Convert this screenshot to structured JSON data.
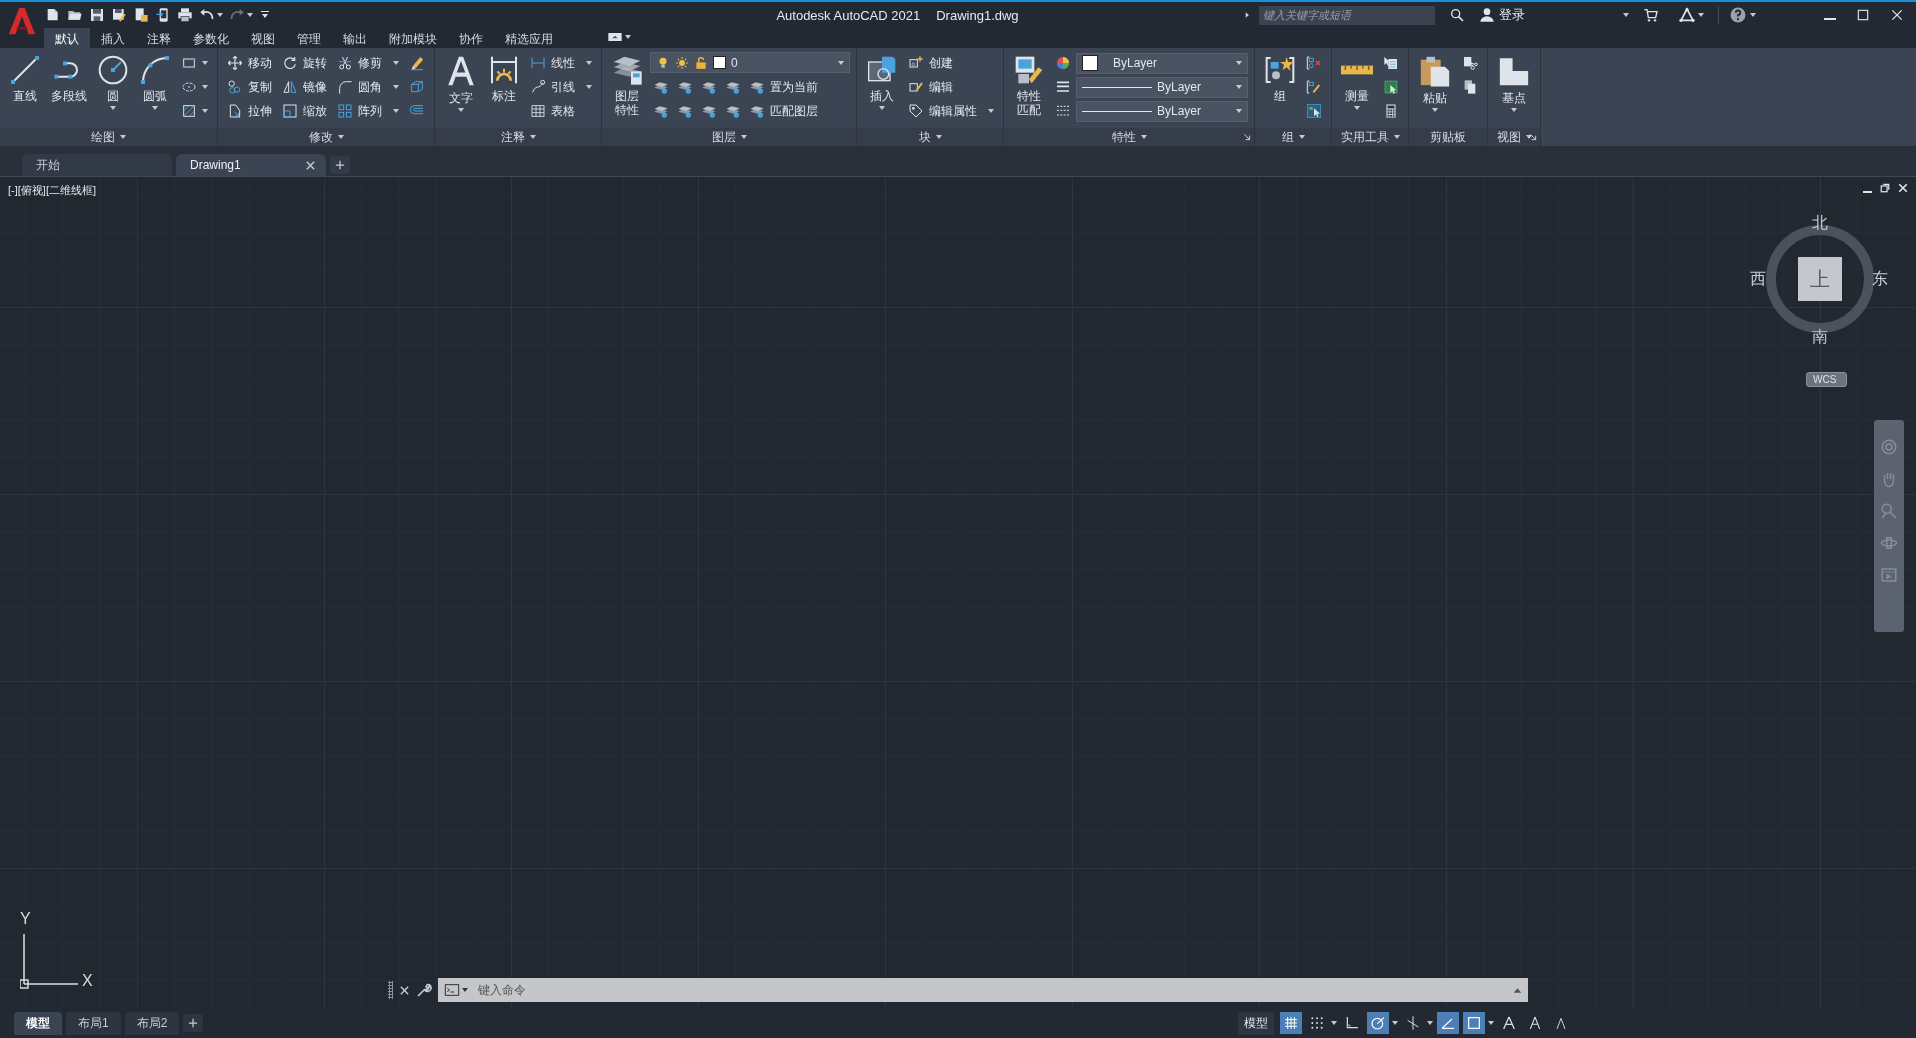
{
  "title_bar": {
    "app_title": "Autodesk AutoCAD 2021",
    "file_name": "Drawing1.dwg",
    "search": {
      "placeholder": "键入关键字或短语"
    },
    "sign_in": "登录"
  },
  "ribbon_tabs": [
    {
      "label": "默认",
      "selected": true
    },
    {
      "label": "插入",
      "selected": false
    },
    {
      "label": "注释",
      "selected": false
    },
    {
      "label": "参数化",
      "selected": false
    },
    {
      "label": "视图",
      "selected": false
    },
    {
      "label": "管理",
      "selected": false
    },
    {
      "label": "输出",
      "selected": false
    },
    {
      "label": "附加模块",
      "selected": false
    },
    {
      "label": "协作",
      "selected": false
    },
    {
      "label": "精选应用",
      "selected": false
    }
  ],
  "ribbon_panels": [
    {
      "title": "绘图",
      "menu": true,
      "launcher": false,
      "columns": [
        {
          "kind": "large",
          "label": "直线",
          "dropdown": false
        },
        {
          "kind": "large",
          "label": "多段线",
          "dropdown": false
        },
        {
          "kind": "large",
          "label": "圆",
          "dropdown": true
        },
        {
          "kind": "large",
          "label": "圆弧",
          "dropdown": true
        },
        {
          "kind": "stack",
          "items": [
            {
              "kind": "icon",
              "dropdown": true
            },
            {
              "kind": "icon",
              "dropdown": true
            },
            {
              "kind": "icon",
              "dropdown": true
            }
          ]
        }
      ]
    },
    {
      "title": "修改",
      "menu": true,
      "launcher": false,
      "columns": [
        {
          "kind": "stack",
          "items": [
            {
              "kind": "small",
              "label": "移动",
              "dropdown": false
            },
            {
              "kind": "small",
              "label": "复制",
              "dropdown": false
            },
            {
              "kind": "small",
              "label": "拉伸",
              "dropdown": false
            }
          ]
        },
        {
          "kind": "stack",
          "items": [
            {
              "kind": "small",
              "label": "旋转",
              "dropdown": false
            },
            {
              "kind": "small",
              "label": "镜像",
              "dropdown": false
            },
            {
              "kind": "small",
              "label": "缩放",
              "dropdown": false
            }
          ]
        },
        {
          "kind": "stack",
          "items": [
            {
              "kind": "small",
              "label": "修剪",
              "dropdown": true
            },
            {
              "kind": "small",
              "label": "圆角",
              "dropdown": true
            },
            {
              "kind": "small",
              "label": "阵列",
              "dropdown": true
            }
          ]
        },
        {
          "kind": "stack",
          "items": [
            {
              "kind": "icon",
              "dropdown": false
            },
            {
              "kind": "icon",
              "dropdown": false
            },
            {
              "kind": "icon",
              "dropdown": false
            }
          ]
        }
      ]
    },
    {
      "title": "注释",
      "menu": true,
      "launcher": false,
      "columns": [
        {
          "kind": "large",
          "label": "文字",
          "dropdown": true
        },
        {
          "kind": "large",
          "label": "标注",
          "dropdown": false
        },
        {
          "kind": "stack",
          "items": [
            {
              "kind": "small",
              "label": "线性",
              "dropdown": true
            },
            {
              "kind": "small",
              "label": "引线",
              "dropdown": true
            },
            {
              "kind": "small",
              "label": "表格",
              "dropdown": false
            }
          ]
        }
      ]
    },
    {
      "title": "图层",
      "menu": true,
      "launcher": false,
      "columns": [
        {
          "kind": "large",
          "label": "图层特性",
          "dropdown": false
        },
        {
          "kind": "stack",
          "items": [
            {
              "kind": "layer_combo",
              "value": "0"
            },
            {
              "kind": "group",
              "items": [
                {
                  "kind": "icon",
                  "dropdown": false
                },
                {
                  "kind": "icon",
                  "dropdown": false
                },
                {
                  "kind": "icon",
                  "dropdown": false
                },
                {
                  "kind": "icon",
                  "dropdown": false
                },
                {
                  "kind": "small",
                  "label": "置为当前",
                  "dropdown": false
                }
              ]
            },
            {
              "kind": "group",
              "items": [
                {
                  "kind": "icon",
                  "dropdown": false
                },
                {
                  "kind": "icon",
                  "dropdown": false
                },
                {
                  "kind": "icon",
                  "dropdown": false
                },
                {
                  "kind": "icon",
                  "dropdown": false
                },
                {
                  "kind": "small",
                  "label": "匹配图层",
                  "dropdown": false
                }
              ]
            }
          ]
        }
      ]
    },
    {
      "title": "块",
      "menu": true,
      "launcher": false,
      "columns": [
        {
          "kind": "large",
          "label": "插入",
          "dropdown": true
        },
        {
          "kind": "stack",
          "items": [
            {
              "kind": "small",
              "label": "创建",
              "dropdown": false
            },
            {
              "kind": "small",
              "label": "编辑",
              "dropdown": false
            },
            {
              "kind": "small",
              "label": "编辑属性",
              "dropdown": true
            }
          ]
        }
      ]
    },
    {
      "title": "特性",
      "menu": true,
      "launcher": true,
      "columns": [
        {
          "kind": "large",
          "label": "特性匹配",
          "dropdown": false
        },
        {
          "kind": "stack",
          "items": [
            {
              "kind": "group",
              "items": [
                {
                  "kind": "icon",
                  "dropdown": false
                },
                {
                  "kind": "color_combo",
                  "value": "ByLayer"
                }
              ]
            },
            {
              "kind": "group",
              "items": [
                {
                  "kind": "icon",
                  "dropdown": false
                },
                {
                  "kind": "line_combo",
                  "value": "ByLayer"
                }
              ]
            },
            {
              "kind": "group",
              "items": [
                {
                  "kind": "icon",
                  "dropdown": false
                },
                {
                  "kind": "line_combo",
                  "value": "ByLayer"
                }
              ]
            }
          ]
        }
      ]
    },
    {
      "title": "组",
      "menu": true,
      "launcher": false,
      "columns": [
        {
          "kind": "large",
          "label": "组",
          "dropdown": false
        },
        {
          "kind": "stack",
          "items": [
            {
              "kind": "icon",
              "dropdown": false
            },
            {
              "kind": "icon",
              "dropdown": false
            },
            {
              "kind": "icon",
              "dropdown": false
            }
          ]
        }
      ]
    },
    {
      "title": "实用工具",
      "menu": true,
      "launcher": false,
      "columns": [
        {
          "kind": "large",
          "label": "测量",
          "dropdown": true
        },
        {
          "kind": "stack",
          "items": [
            {
              "kind": "icon",
              "dropdown": false
            },
            {
              "kind": "icon",
              "dropdown": false
            },
            {
              "kind": "icon",
              "dropdown": false
            }
          ]
        }
      ]
    },
    {
      "title": "剪贴板",
      "menu": false,
      "launcher": false,
      "columns": [
        {
          "kind": "large",
          "label": "粘贴",
          "dropdown": true
        },
        {
          "kind": "stack",
          "items": [
            {
              "kind": "icon",
              "dropdown": false
            },
            {
              "kind": "icon",
              "dropdown": false
            }
          ]
        }
      ]
    },
    {
      "title": "视图",
      "menu": true,
      "launcher": true,
      "columns": [
        {
          "kind": "large",
          "label": "基点",
          "dropdown": true
        }
      ]
    }
  ],
  "document_tabs": [
    {
      "label": "开始",
      "selected": false,
      "closable": false
    },
    {
      "label": "Drawing1",
      "selected": true,
      "closable": true
    }
  ],
  "viewport": {
    "view_label": "[-][俯视][二维线框]",
    "viewcube": {
      "north": "北",
      "south": "南",
      "east": "东",
      "west": "西",
      "face": "上",
      "ucs_button": "WCS"
    },
    "ucs_axes": {
      "y": "Y",
      "x": "X"
    }
  },
  "command_line": {
    "placeholder": "键入命令"
  },
  "layout_tabs": [
    {
      "label": "模型",
      "selected": true
    },
    {
      "label": "布局1",
      "selected": false
    },
    {
      "label": "布局2",
      "selected": false
    }
  ],
  "status_bar": {
    "mode_label": "模型",
    "toggles": [
      {
        "on": true,
        "dropdown": false
      },
      {
        "on": false,
        "dropdown": true
      },
      {
        "on": false,
        "dropdown": false
      },
      {
        "on": true,
        "dropdown": true
      },
      {
        "on": false,
        "dropdown": true
      },
      {
        "on": true,
        "dropdown": false
      },
      {
        "on": true,
        "dropdown": true
      },
      {
        "on": false,
        "dropdown": false
      },
      {
        "on": false,
        "dropdown": false
      },
      {
        "on": false,
        "dropdown": false
      }
    ]
  }
}
